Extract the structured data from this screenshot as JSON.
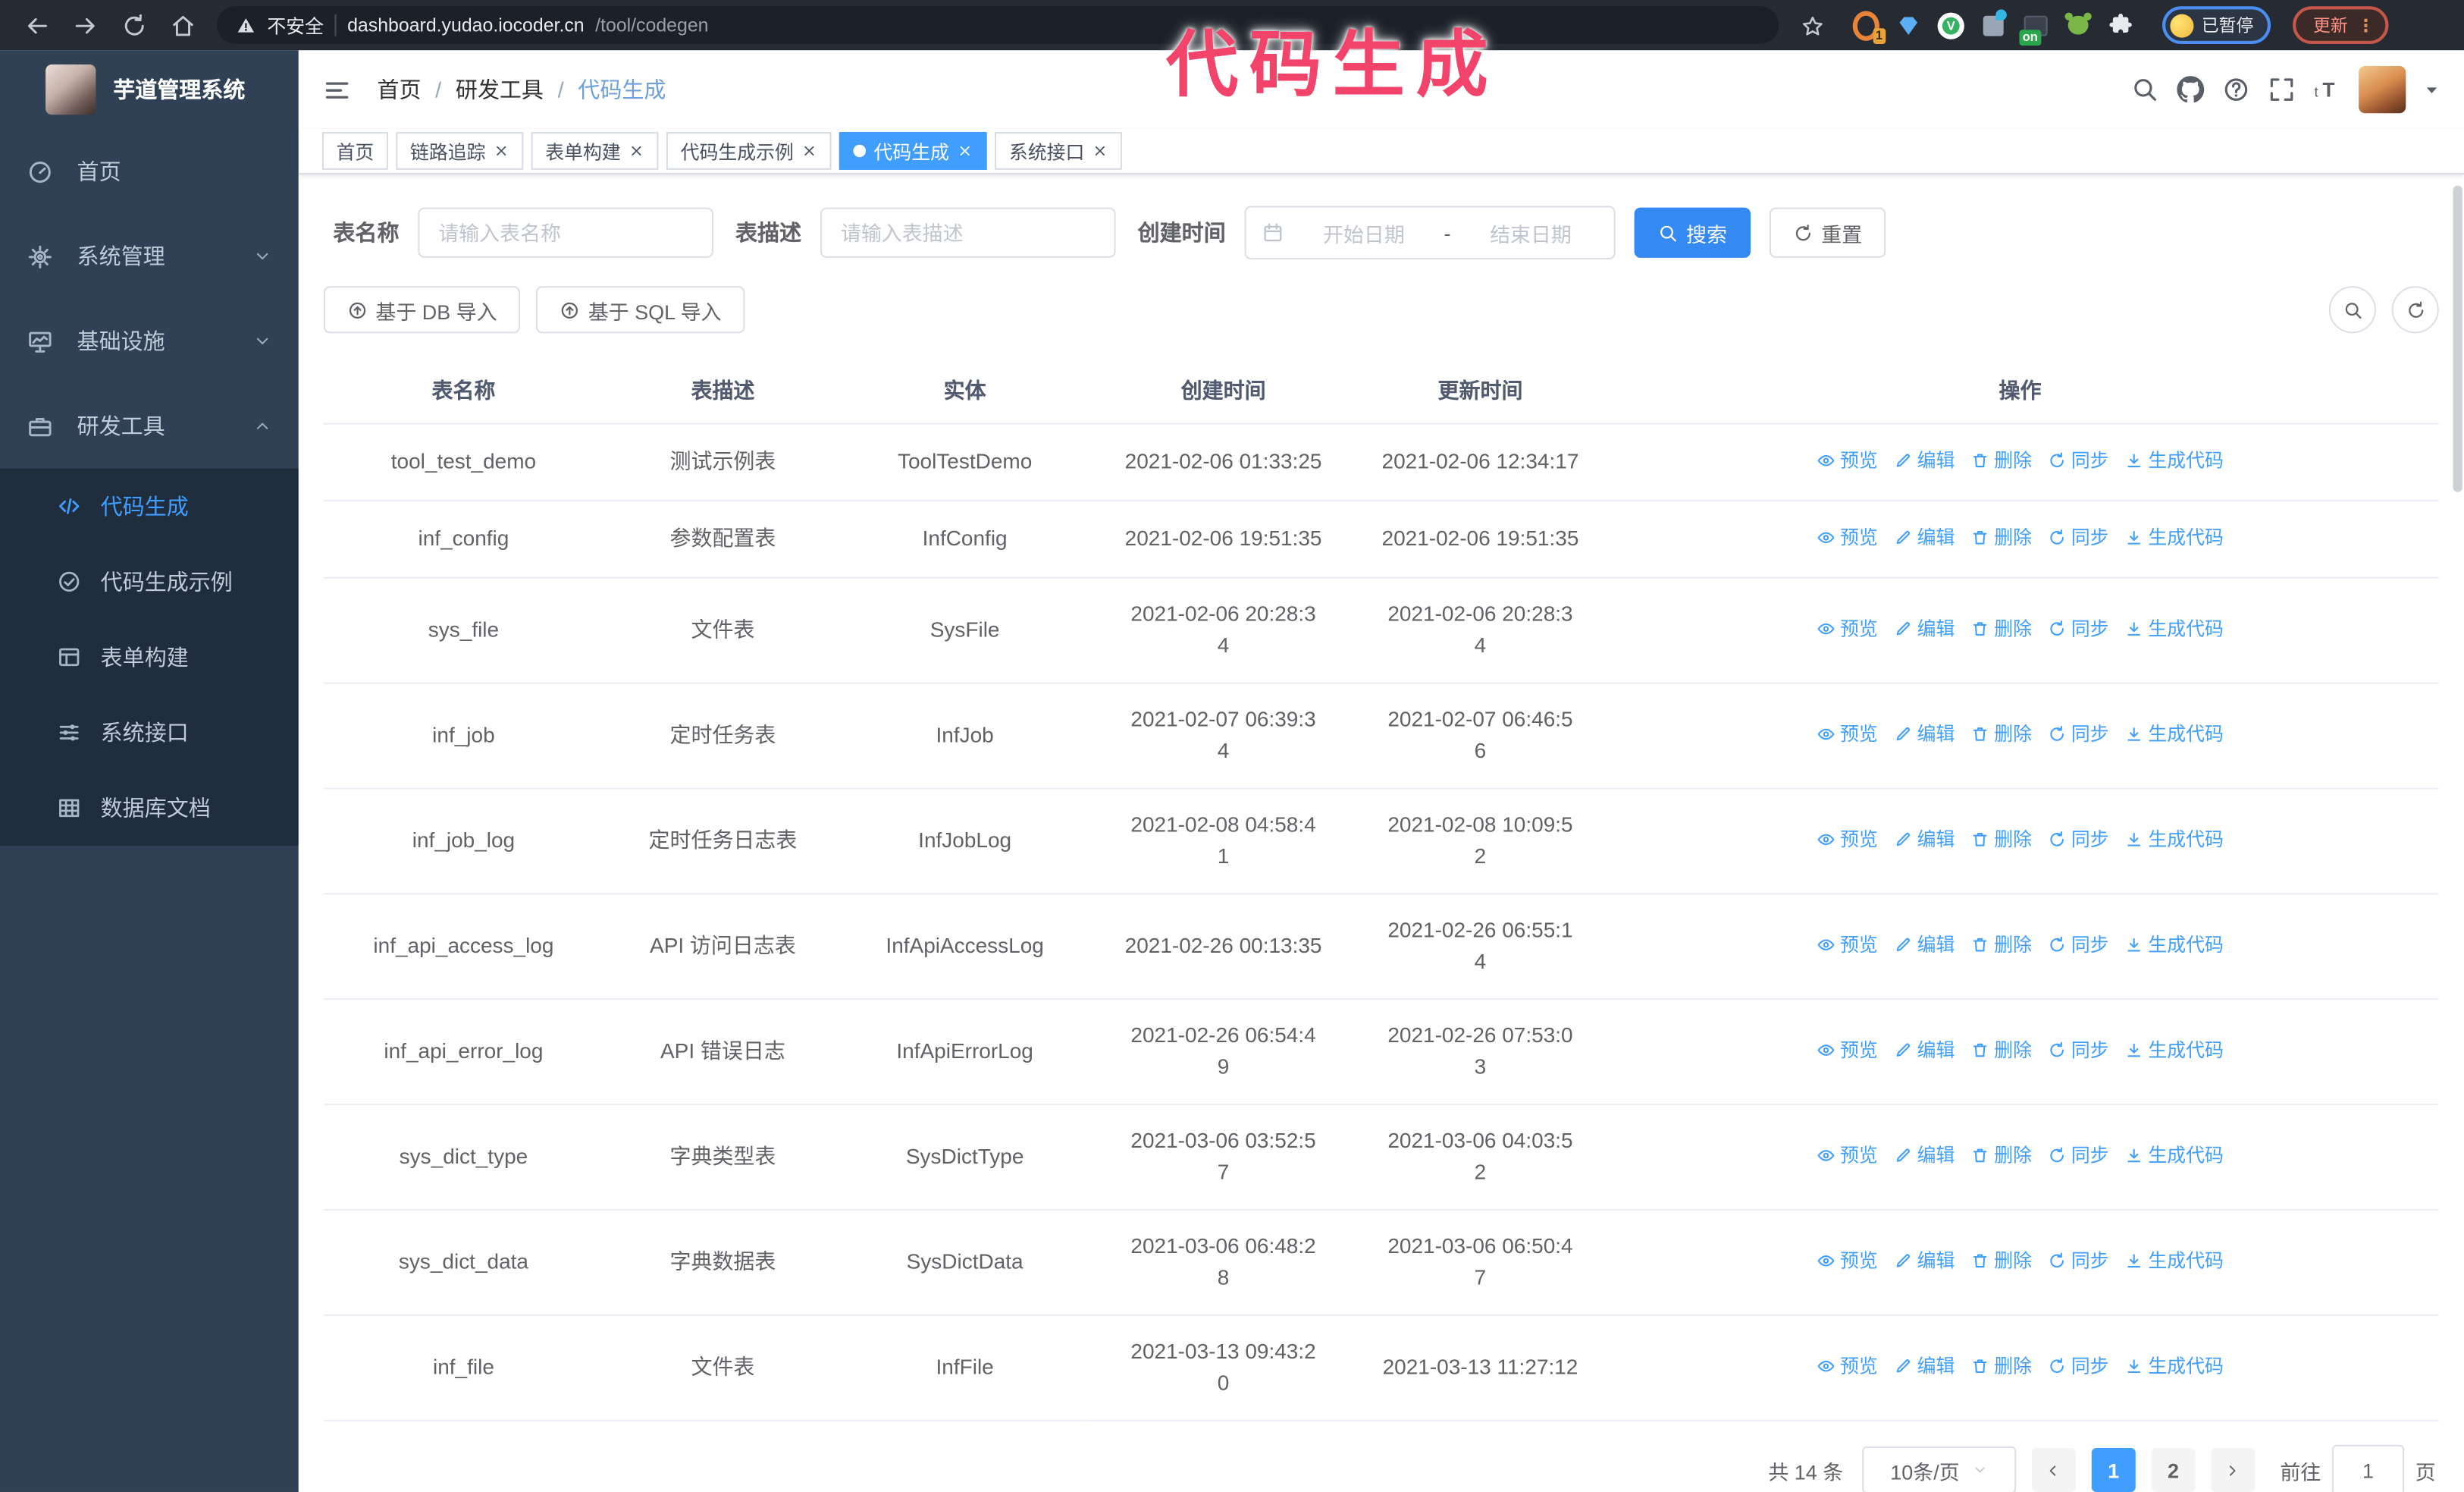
{
  "colors": {
    "accent": "#409EFF",
    "sidebar_bg": "#304156",
    "submenu_bg": "#1f2d3d",
    "annotation": "#F2436A",
    "tag_active": "#409EFF",
    "search_button": "#3589F2"
  },
  "annotation": "代码生成",
  "browser": {
    "security_label": "不安全",
    "url_host": "dashboard.yudao.iocoder.cn",
    "url_path": "/tool/codegen",
    "profile_chip": "已暂停",
    "update_button": "更新",
    "update_dots": "⋮",
    "extension_badges": {
      "session": "1",
      "switch": "on"
    }
  },
  "sidebar": {
    "logo_title": "芋道管理系统",
    "menu": [
      {
        "key": "home",
        "label": "首页",
        "icon": "gauge",
        "chevron": ""
      },
      {
        "key": "system",
        "label": "系统管理",
        "icon": "gear",
        "chevron": "chev-down"
      },
      {
        "key": "infra",
        "label": "基础设施",
        "icon": "monitor",
        "chevron": "chev-down"
      },
      {
        "key": "devtools",
        "label": "研发工具",
        "icon": "toolbox",
        "chevron": "chev-up"
      }
    ],
    "submenu": [
      {
        "key": "codegen",
        "label": "代码生成",
        "icon": "code",
        "active": true
      },
      {
        "key": "codegen-example",
        "label": "代码生成示例",
        "icon": "check-circle",
        "active": false
      },
      {
        "key": "form-builder",
        "label": "表单构建",
        "icon": "form",
        "active": false
      },
      {
        "key": "api",
        "label": "系统接口",
        "icon": "sliders",
        "active": false
      },
      {
        "key": "db-doc",
        "label": "数据库文档",
        "icon": "grid",
        "active": false
      }
    ]
  },
  "breadcrumb": [
    "首页",
    "研发工具",
    "代码生成"
  ],
  "tags": [
    {
      "key": "home",
      "label": "首页",
      "closable": false,
      "active": false
    },
    {
      "key": "tracing",
      "label": "链路追踪",
      "closable": true,
      "active": false
    },
    {
      "key": "form-builder",
      "label": "表单构建",
      "closable": true,
      "active": false
    },
    {
      "key": "codegen-example",
      "label": "代码生成示例",
      "closable": true,
      "active": false
    },
    {
      "key": "codegen",
      "label": "代码生成",
      "closable": true,
      "active": true
    },
    {
      "key": "api",
      "label": "系统接口",
      "closable": true,
      "active": false
    }
  ],
  "search": {
    "name_label": "表名称",
    "name_placeholder": "请输入表名称",
    "desc_label": "表描述",
    "desc_placeholder": "请输入表描述",
    "time_label": "创建时间",
    "start_placeholder": "开始日期",
    "range_separator": "-",
    "end_placeholder": "结束日期",
    "search_button": "搜索",
    "reset_button": "重置"
  },
  "actions_bar": {
    "db_import": "基于 DB 导入",
    "sql_import": "基于 SQL 导入"
  },
  "table": {
    "columns": [
      "表名称",
      "表描述",
      "实体",
      "创建时间",
      "更新时间",
      "操作"
    ],
    "row_actions": [
      {
        "key": "preview",
        "label": "预览",
        "icon": "eye"
      },
      {
        "key": "edit",
        "label": "编辑",
        "icon": "edit"
      },
      {
        "key": "delete",
        "label": "删除",
        "icon": "trash"
      },
      {
        "key": "sync",
        "label": "同步",
        "icon": "sync"
      },
      {
        "key": "generate",
        "label": "生成代码",
        "icon": "download"
      }
    ],
    "rows": [
      {
        "name": "tool_test_demo",
        "desc": "测试示例表",
        "entity": "ToolTestDemo",
        "created": "2021-02-06 01:33:25",
        "updated": "2021-02-06 12:34:17"
      },
      {
        "name": "inf_config",
        "desc": "参数配置表",
        "entity": "InfConfig",
        "created": "2021-02-06 19:51:35",
        "updated": "2021-02-06 19:51:35"
      },
      {
        "name": "sys_file",
        "desc": "文件表",
        "entity": "SysFile",
        "created": "2021-02-06 20:28:3\n4",
        "updated": "2021-02-06 20:28:3\n4"
      },
      {
        "name": "inf_job",
        "desc": "定时任务表",
        "entity": "InfJob",
        "created": "2021-02-07 06:39:3\n4",
        "updated": "2021-02-07 06:46:5\n6"
      },
      {
        "name": "inf_job_log",
        "desc": "定时任务日志表",
        "entity": "InfJobLog",
        "created": "2021-02-08 04:58:4\n1",
        "updated": "2021-02-08 10:09:5\n2"
      },
      {
        "name": "inf_api_access_log",
        "desc": "API 访问日志表",
        "entity": "InfApiAccessLog",
        "created": "2021-02-26 00:13:35",
        "updated": "2021-02-26 06:55:1\n4"
      },
      {
        "name": "inf_api_error_log",
        "desc": "API 错误日志",
        "entity": "InfApiErrorLog",
        "created": "2021-02-26 06:54:4\n9",
        "updated": "2021-02-26 07:53:0\n3"
      },
      {
        "name": "sys_dict_type",
        "desc": "字典类型表",
        "entity": "SysDictType",
        "created": "2021-03-06 03:52:5\n7",
        "updated": "2021-03-06 04:03:5\n2"
      },
      {
        "name": "sys_dict_data",
        "desc": "字典数据表",
        "entity": "SysDictData",
        "created": "2021-03-06 06:48:2\n8",
        "updated": "2021-03-06 06:50:4\n7"
      },
      {
        "name": "inf_file",
        "desc": "文件表",
        "entity": "InfFile",
        "created": "2021-03-13 09:43:2\n0",
        "updated": "2021-03-13 11:27:12"
      }
    ]
  },
  "pagination": {
    "total": "共 14 条",
    "page_size": "10条/页",
    "pages": [
      "1",
      "2"
    ],
    "active_page": "1",
    "goto_label": "前往",
    "goto_value": "1",
    "suffix": "页"
  }
}
